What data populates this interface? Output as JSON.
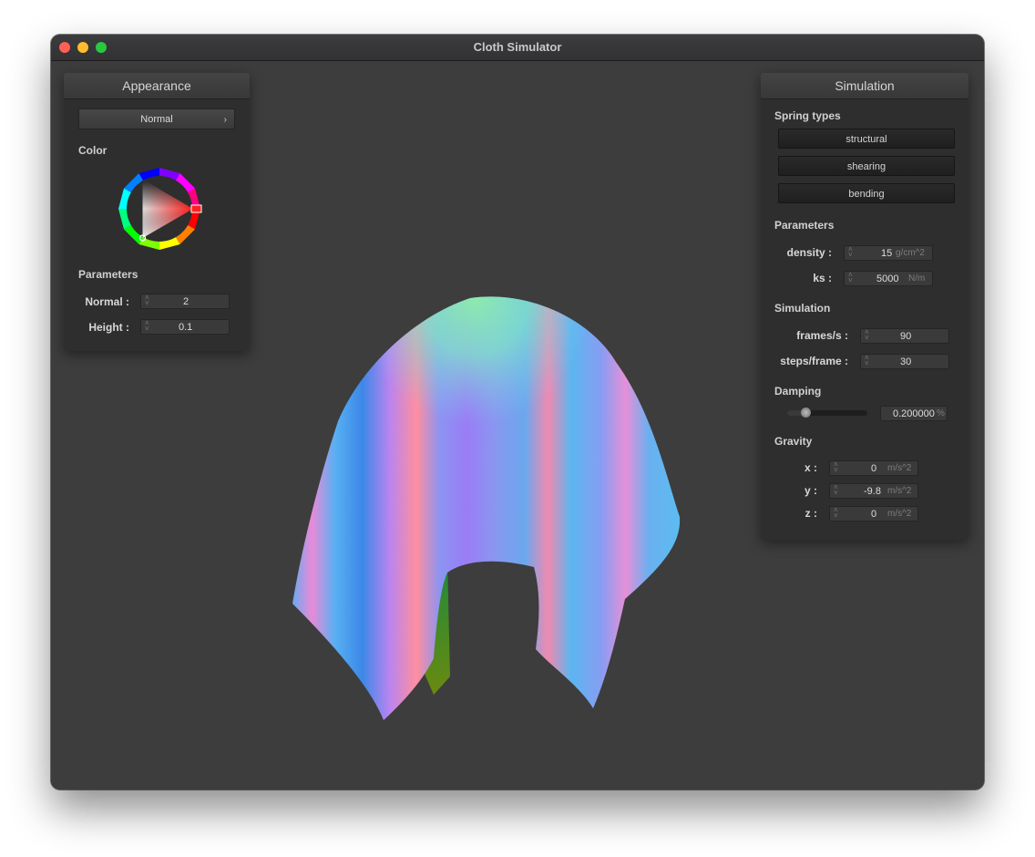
{
  "window": {
    "title": "Cloth Simulator"
  },
  "appearance": {
    "title": "Appearance",
    "shader": "Normal",
    "color_label": "Color",
    "parameters_label": "Parameters",
    "params": [
      {
        "label": "Normal :",
        "value": "2"
      },
      {
        "label": "Height :",
        "value": "0.1"
      }
    ]
  },
  "simulation": {
    "title": "Simulation",
    "spring_types_label": "Spring types",
    "springs": [
      "structural",
      "shearing",
      "bending"
    ],
    "parameters_label": "Parameters",
    "density": {
      "label": "density :",
      "value": "15",
      "unit": "g/cm^2"
    },
    "ks": {
      "label": "ks :",
      "value": "5000",
      "unit": "N/m"
    },
    "simulation_label": "Simulation",
    "fps": {
      "label": "frames/s :",
      "value": "90"
    },
    "steps": {
      "label": "steps/frame :",
      "value": "30"
    },
    "damping_label": "Damping",
    "damping": {
      "value": "0.200000",
      "unit": "%",
      "slider_fraction": 0.2
    },
    "gravity_label": "Gravity",
    "gravity": [
      {
        "label": "x :",
        "value": "0",
        "unit": "m/s^2"
      },
      {
        "label": "y :",
        "value": "-9.8",
        "unit": "m/s^2"
      },
      {
        "label": "z :",
        "value": "0",
        "unit": "m/s^2"
      }
    ]
  },
  "colors": {
    "background": "#3d3d3d",
    "panel": "#2e2e2e",
    "picker_selected": "#ff0000"
  }
}
